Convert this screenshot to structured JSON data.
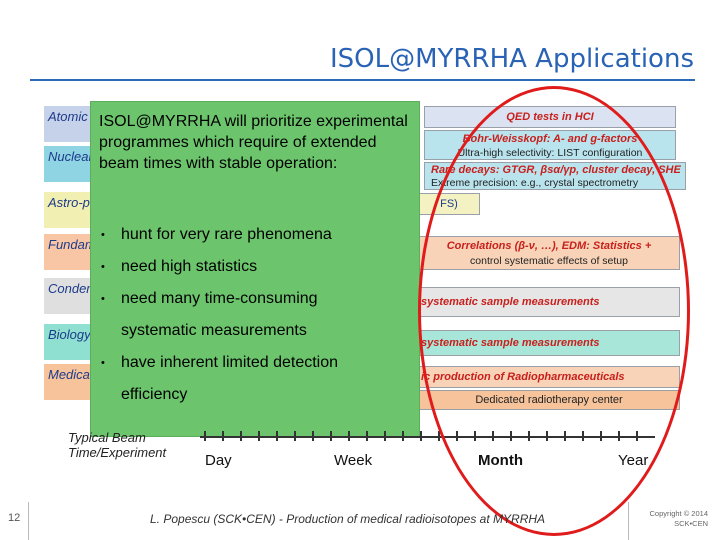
{
  "slide": {
    "title": "ISOL@MYRRHA Applications",
    "page_number": "12",
    "footer_text": "L. Popescu (SCK•CEN) - Production of medical radioisotopes at MYRRHA",
    "copyright_line1": "Copyright © 2014",
    "copyright_line2": "SCK•CEN"
  },
  "rows": [
    {
      "label": "Atomic Physics",
      "color": "#c6d2ea"
    },
    {
      "label": "Nuclear Physics",
      "color": "#8fd4e3"
    },
    {
      "label": "Astro-physics",
      "color": "#f2efb3"
    },
    {
      "label": "Fundam. Interact.",
      "color": "#f8c6a4"
    },
    {
      "label": "Condens. Matter",
      "color": "#dfdfdf"
    },
    {
      "label": "Biology",
      "color": "#8fe0d0"
    },
    {
      "label": "Medical Applic.",
      "color": "#f6c39a"
    }
  ],
  "apps": {
    "qed": "QED tests in HCI",
    "bohr": "Bohr-Weisskopf: A- and g-factors",
    "bohr_sub": "Ultra-high selectivity: LIST configuration",
    "rare": "Rare decays: GTGR, βsα/γp, cluster decay, SHE",
    "rare_sub": "Extreme precision: e.g., crystal spectrometry",
    "astro": "FS)",
    "corr": "Correlations (β-ν, …), EDM: Statistics +",
    "corr_sub": "control systematic effects of setup",
    "sys1": "systematic sample measurements",
    "sys2": "systematic sample measurements",
    "radio": "ic production of Radiopharmaceuticals",
    "dedicated": "Dedicated radiotherapy center"
  },
  "panel": {
    "intro": "ISOL@MYRRHA will prioritize experimental programmes which require of extended beam times with stable operation:",
    "bullets": [
      {
        "line1": "hunt for very rare phenomena",
        "line2": ""
      },
      {
        "line1": "need high statistics",
        "line2": ""
      },
      {
        "line1": "need many time-consuming",
        "line2": "systematic measurements"
      },
      {
        "line1": "have inherent limited detection",
        "line2": "efficiency"
      }
    ],
    "bullet_glyph": "•"
  },
  "axis": {
    "label_line1": "Typical Beam",
    "label_line2": "Time/Experiment",
    "ticks": [
      "Day",
      "Week",
      "Month",
      "Year"
    ]
  }
}
